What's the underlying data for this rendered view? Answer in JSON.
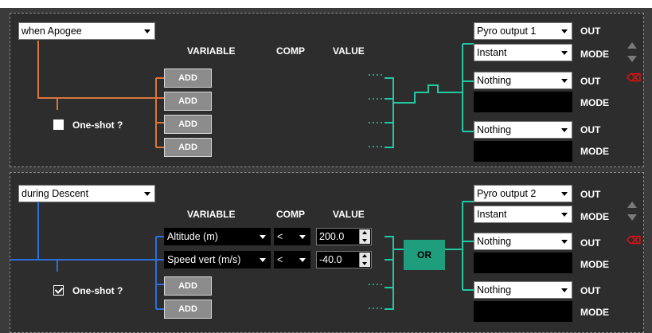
{
  "colors": {
    "wire_orange": "#d9763a",
    "wire_teal": "#22c9a0",
    "wire_blue": "#2e6fd8",
    "delete_red": "#e01010"
  },
  "headers": {
    "variable": "VARIABLE",
    "comp": "COMP",
    "value": "VALUE",
    "out": "OUT",
    "mode": "MODE",
    "add": "ADD",
    "or": "OR"
  },
  "rule1": {
    "trigger": "when Apogee",
    "oneshot_label": "One-shot ?",
    "oneshot_checked": false,
    "outputs": [
      {
        "out": "Pyro output 1",
        "mode": "Instant"
      },
      {
        "out": "Nothing",
        "mode": ""
      },
      {
        "out": "Nothing",
        "mode": ""
      }
    ]
  },
  "rule2": {
    "trigger": "during Descent",
    "oneshot_label": "One-shot ?",
    "oneshot_checked": true,
    "conditions": [
      {
        "variable": "Altitude (m)",
        "comp": "<",
        "value": "200.0"
      },
      {
        "variable": "Speed vert (m/s)",
        "comp": "<",
        "value": "-40.0"
      }
    ],
    "outputs": [
      {
        "out": "Pyro output 2",
        "mode": "Instant"
      },
      {
        "out": "Nothing",
        "mode": ""
      },
      {
        "out": "Nothing",
        "mode": ""
      }
    ]
  },
  "icons": [
    "move-up-icon",
    "move-down-icon",
    "delete-icon",
    "checkbox-icon"
  ]
}
